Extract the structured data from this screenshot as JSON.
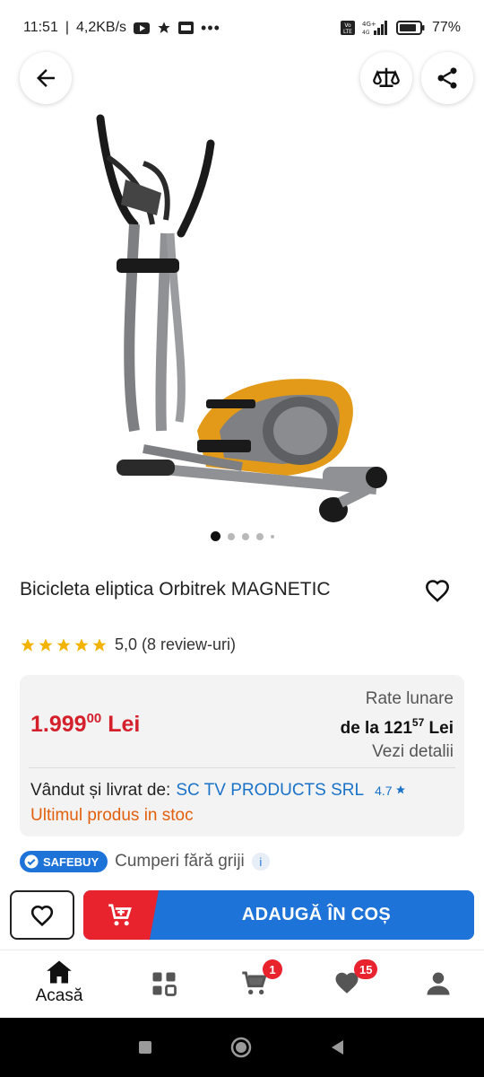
{
  "status_bar": {
    "time": "11:51",
    "speed": "4,2KB/s",
    "network_top": "4G+",
    "network_bottom": "4G",
    "volte_label": "Vo LTE",
    "battery": "77%"
  },
  "product": {
    "title": "Bicicleta eliptica Orbitrek MAGNETIC",
    "image_count": 5,
    "active_image_index": 0,
    "rating_value": "5,0",
    "rating_text": "5,0 (8 review-uri)",
    "stars": 5
  },
  "price": {
    "main": "1.999",
    "decimals": "00",
    "currency": "Lei"
  },
  "installments": {
    "label": "Rate lunare",
    "prefix": "de la",
    "amount": "121",
    "decimals": "57",
    "currency": "Lei",
    "details_link": "Vezi detalii"
  },
  "seller": {
    "prefix": "Vândut și livrat de:",
    "name": "SC TV PRODUCTS SRL",
    "rating": "4.7"
  },
  "stock_text": "Ultimul produs in stoc",
  "safebuy": {
    "badge": "SAFEBUY",
    "text": "Cumperi fără griji",
    "info": "i"
  },
  "actions": {
    "add_to_cart": "ADAUGĂ ÎN COȘ"
  },
  "bottom_nav": {
    "home_label": "Acasă",
    "cart_badge": "1",
    "favorites_badge": "15"
  },
  "colors": {
    "price_red": "#d4202b",
    "primary_blue": "#1e73d8",
    "accent_red": "#e8232e",
    "stock_orange": "#e2600d",
    "star_yellow": "#f5b301"
  }
}
